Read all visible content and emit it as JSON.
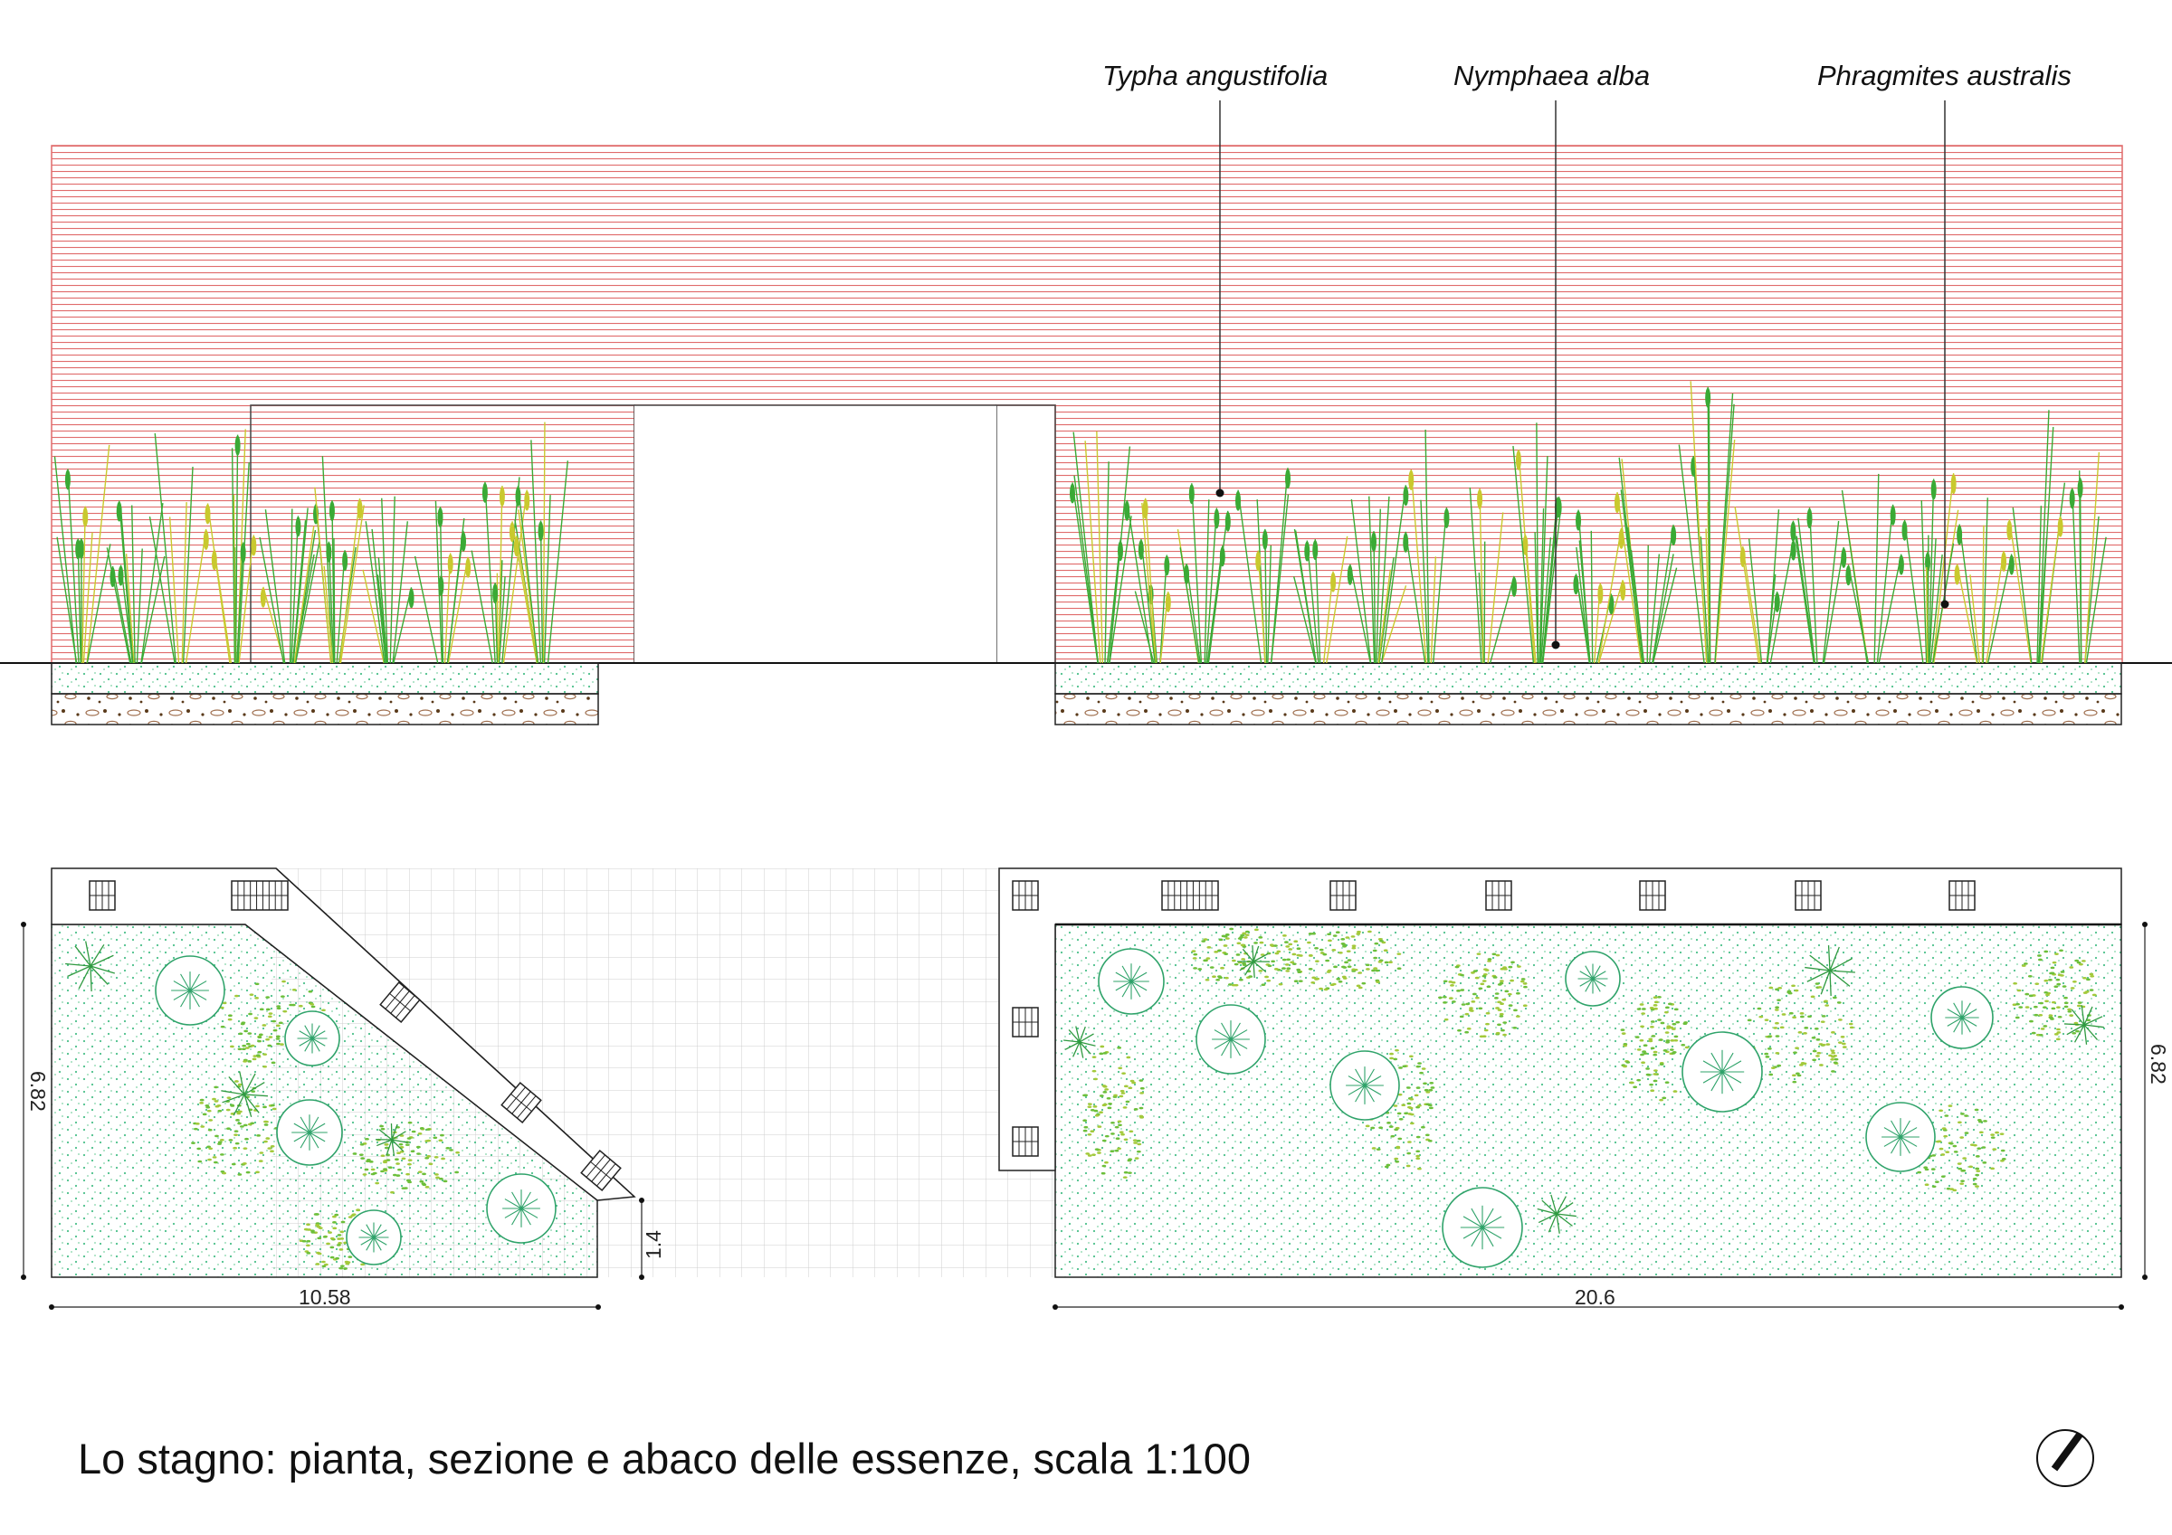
{
  "section": {
    "labels": [
      {
        "text": "Typha angustifolia"
      },
      {
        "text": "Nymphaea alba"
      },
      {
        "text": "Phragmites australis"
      }
    ]
  },
  "plan": {
    "dimensions": {
      "left_width": "10.58",
      "left_height": "6.82",
      "step": "1.4",
      "right_width": "20.6",
      "right_height": "6.82"
    }
  },
  "caption": "Lo stagno: pianta, sezione e abaco delle essenze, scala 1:100",
  "colors": {
    "wall_hatch": "#e06a6a",
    "water_dots": "#4cc08a",
    "reed_green": "#3aaa35",
    "cattail_yellow": "#c9c92e",
    "gravel": "#8b5a2b",
    "grid": "#cfcfcf"
  },
  "icons": [
    "north-arrow-icon",
    "water-lily-icon",
    "reed-icon",
    "bench-icon"
  ]
}
